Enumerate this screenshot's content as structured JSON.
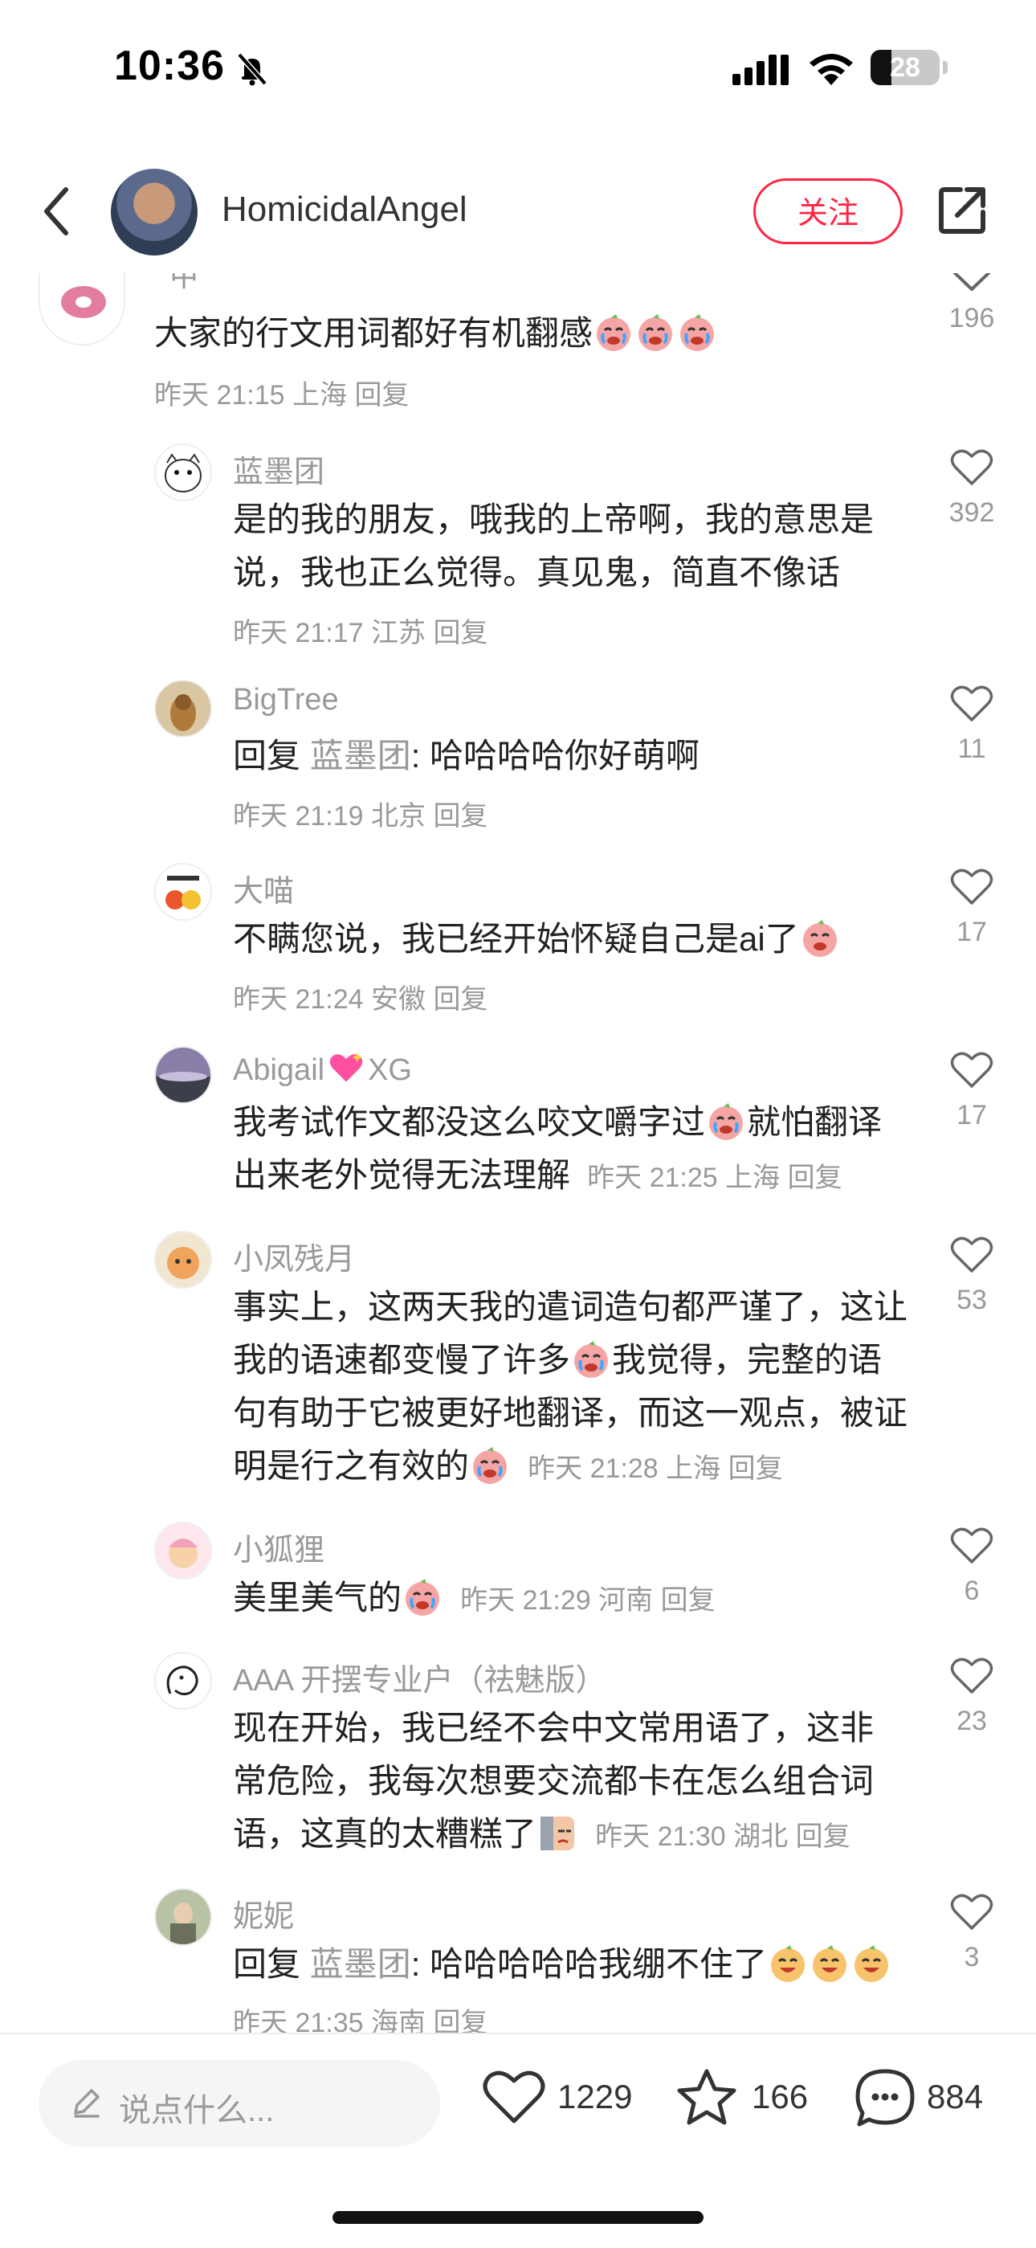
{
  "status_bar": {
    "time": "10:36",
    "battery": "28"
  },
  "nav": {
    "author_name": "HomicidalAngel",
    "follow_label": "关注"
  },
  "top_comment": {
    "name_partial": "甲",
    "text": "大家的行文用词都好有机翻感",
    "time": "昨天 21:15",
    "location": "上海",
    "reply_label": "回复",
    "likes": "196"
  },
  "replies": [
    {
      "name": "蓝墨团",
      "text": "是的我的朋友，哦我的上帝啊，我的意思是说，我也正么觉得。真见鬼，简直不像话",
      "time": "昨天 21:17",
      "location": "江苏",
      "reply_label": "回复",
      "likes": "392"
    },
    {
      "name": "BigTree",
      "reply_prefix": "回复",
      "reply_target": "蓝墨团",
      "text": ": 哈哈哈哈你好萌啊",
      "time": "昨天 21:19",
      "location": "北京",
      "reply_label": "回复",
      "likes": "11"
    },
    {
      "name": "大喵",
      "text": "不瞒您说，我已经开始怀疑自己是ai了",
      "time": "昨天 21:24",
      "location": "安徽",
      "reply_label": "回复",
      "likes": "17"
    },
    {
      "name_a": "Abigail",
      "name_b": "XG",
      "text_a": "我考试作文都没这么咬文嚼字过",
      "text_b": "就怕翻译出来老外觉得无法理解",
      "time": "昨天 21:25",
      "location": "上海",
      "reply_label": "回复",
      "likes": "17"
    },
    {
      "name": "小凤残月",
      "text_a": "事实上，这两天我的遣词造句都严谨了，这让我的语速都变慢了许多",
      "text_b": "我觉得，完整的语句有助于它被更好地翻译，而这一观点，被证明是行之有效的",
      "time": "昨天 21:28",
      "location": "上海",
      "reply_label": "回复",
      "likes": "53"
    },
    {
      "name": "小狐狸",
      "text": "美里美气的",
      "time": "昨天 21:29",
      "location": "河南",
      "reply_label": "回复",
      "likes": "6"
    },
    {
      "name": "AAA 开摆专业户（祛魅版）",
      "text": "现在开始，我已经不会中文常用语了，这非常危险，我每次想要交流都卡在怎么组合词语，这真的太糟糕了",
      "time": "昨天 21:30",
      "location": "湖北",
      "reply_label": "回复",
      "likes": "23"
    },
    {
      "name": "妮妮",
      "reply_prefix": "回复",
      "reply_target": "蓝墨团",
      "text": ": 哈哈哈哈哈我绷不住了",
      "time": "昨天 21:35",
      "location": "海南",
      "reply_label": "回复",
      "likes": "3"
    }
  ],
  "bottom_bar": {
    "input_placeholder": "说点什么...",
    "likes": "1229",
    "stars": "166",
    "comments": "884"
  },
  "colors": {
    "accent": "#ff2442",
    "muted_text": "#999999",
    "body_text": "#222222"
  }
}
